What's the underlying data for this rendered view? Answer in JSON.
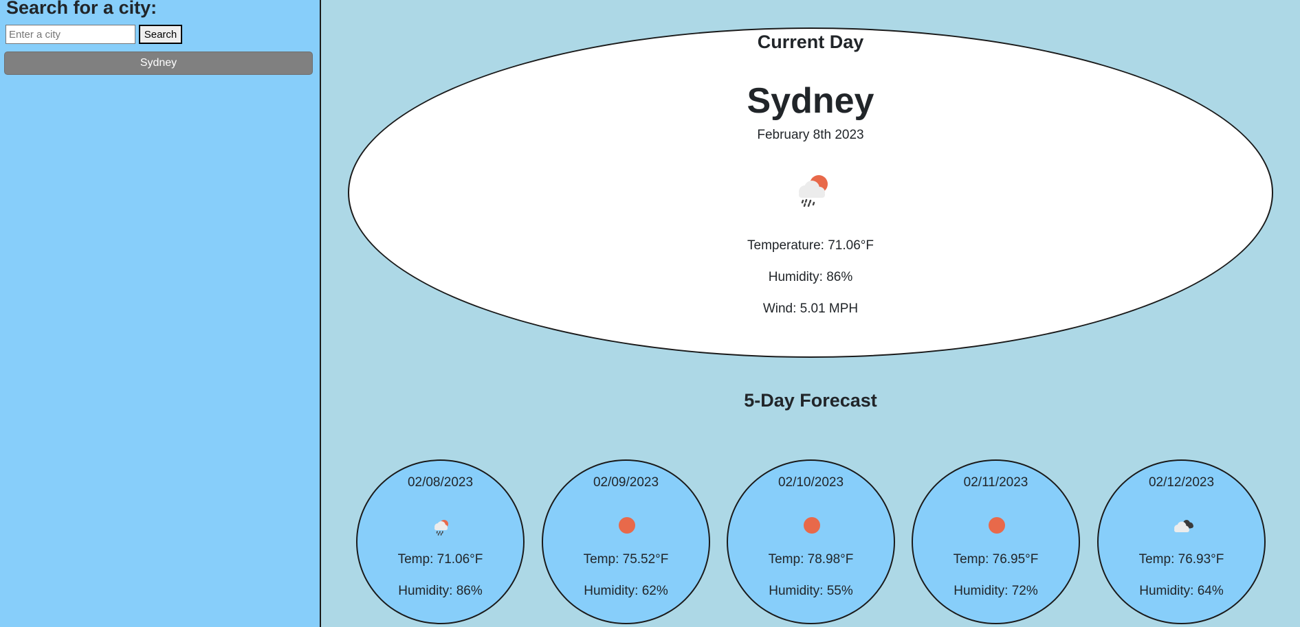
{
  "sidebar": {
    "title": "Search for a city:",
    "search_placeholder": "Enter a city",
    "search_button": "Search",
    "history": [
      "Sydney"
    ]
  },
  "current": {
    "title": "Current Day",
    "city": "Sydney",
    "date": "February 8th 2023",
    "icon": "rain-sun-icon",
    "temperature": "Temperature: 71.06°F",
    "humidity": "Humidity: 86%",
    "wind": "Wind: 5.01 MPH"
  },
  "forecast": {
    "title": "5-Day Forecast",
    "days": [
      {
        "date": "02/08/2023",
        "icon": "rain-sun-icon",
        "temp": "Temp: 71.06°F",
        "humidity": "Humidity: 86%"
      },
      {
        "date": "02/09/2023",
        "icon": "sun-icon",
        "temp": "Temp: 75.52°F",
        "humidity": "Humidity: 62%"
      },
      {
        "date": "02/10/2023",
        "icon": "sun-icon",
        "temp": "Temp: 78.98°F",
        "humidity": "Humidity: 55%"
      },
      {
        "date": "02/11/2023",
        "icon": "sun-icon",
        "temp": "Temp: 76.95°F",
        "humidity": "Humidity: 72%"
      },
      {
        "date": "02/12/2023",
        "icon": "cloudy-icon",
        "temp": "Temp: 76.93°F",
        "humidity": "Humidity: 64%"
      }
    ]
  },
  "colors": {
    "sidebar_bg": "#87cefa",
    "main_bg": "#add8e6",
    "card_bg": "#ffffff",
    "forecast_card_bg": "#87cefa",
    "history_button_bg": "#808080",
    "sun": "#e8694a",
    "cloud_light": "#e8e8e8",
    "cloud_dark": "#3a3a3a"
  }
}
